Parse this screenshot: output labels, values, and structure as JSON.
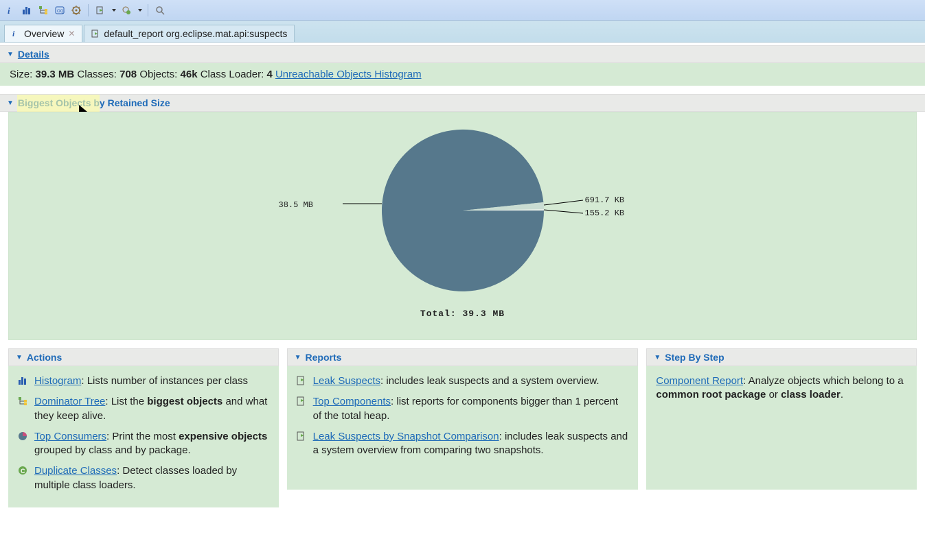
{
  "toolbar": {
    "icons": [
      "info",
      "histogram",
      "tree",
      "oql",
      "gear",
      "run",
      "run-gear",
      "search"
    ]
  },
  "tabs": {
    "active": "Overview",
    "secondary": "default_report  org.eclipse.mat.api:suspects"
  },
  "details": {
    "header": "Details",
    "size_label": "Size:",
    "size_value": "39.3 MB",
    "classes_label": "Classes:",
    "classes_value": "708",
    "objects_label": "Objects:",
    "objects_value": "46k",
    "classloader_label": "Class Loader:",
    "classloader_value": "4",
    "link": "Unreachable Objects Histogram"
  },
  "biggest": {
    "header": "Biggest Objects by Retained Size",
    "total_label": "Total: 39.3 MB",
    "labels": {
      "main": "38.5 MB",
      "slice1": "691.7 KB",
      "slice2": "155.2 KB"
    }
  },
  "chart_data": {
    "type": "pie",
    "title": "Biggest Objects by Retained Size",
    "total_label": "Total: 39.3 MB",
    "slices": [
      {
        "label": "38.5 MB",
        "value_mb": 38.5
      },
      {
        "label": "691.7 KB",
        "value_mb": 0.6755
      },
      {
        "label": "155.2 KB",
        "value_mb": 0.1516
      }
    ],
    "total_mb": 39.3
  },
  "actions": {
    "header": "Actions",
    "items": [
      {
        "link": "Histogram",
        "text": ": Lists number of instances per class"
      },
      {
        "link": "Dominator Tree",
        "text_pre": ": List the ",
        "bold": "biggest objects",
        "text_post": " and what they keep alive."
      },
      {
        "link": "Top Consumers",
        "text_pre": ": Print the most ",
        "bold": "expensive objects",
        "text_post": " grouped by class and by package."
      },
      {
        "link": "Duplicate Classes",
        "text": ": Detect classes loaded by multiple class loaders."
      }
    ]
  },
  "reports": {
    "header": "Reports",
    "items": [
      {
        "link": "Leak Suspects",
        "text": ": includes leak suspects and a system overview."
      },
      {
        "link": "Top Components",
        "text": ": list reports for components bigger than 1 percent of the total heap."
      },
      {
        "link": "Leak Suspects by Snapshot Comparison",
        "text": ": includes leak suspects and a system overview from comparing two snapshots."
      }
    ]
  },
  "stepbystep": {
    "header": "Step By Step",
    "link": "Component Report",
    "text_pre": ": Analyze objects which belong to a ",
    "bold1": "common root package",
    "or": " or ",
    "bold2": "class loader",
    "suffix": "."
  }
}
